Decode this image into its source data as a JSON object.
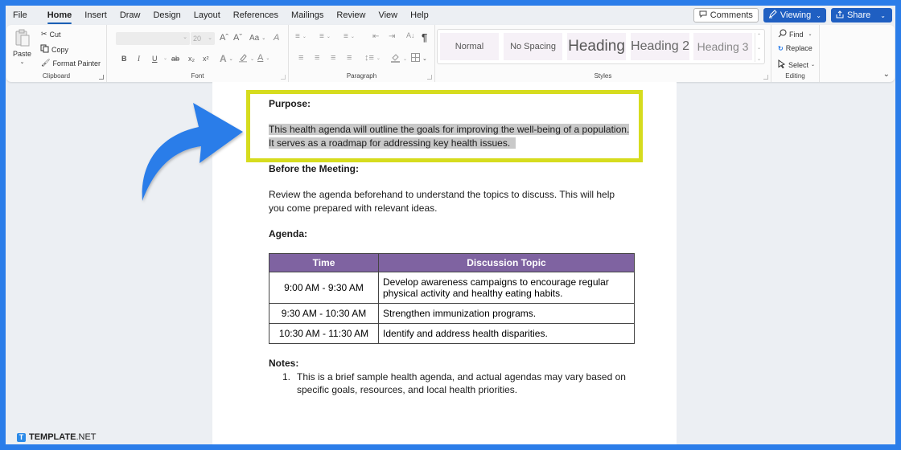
{
  "menu": {
    "tabs": [
      "File",
      "Home",
      "Insert",
      "Draw",
      "Design",
      "Layout",
      "References",
      "Mailings",
      "Review",
      "View",
      "Help"
    ],
    "active_tab": "Home",
    "comments_label": "Comments",
    "viewing_label": "Viewing",
    "share_label": "Share"
  },
  "ribbon": {
    "clipboard": {
      "label": "Clipboard",
      "paste": "Paste",
      "cut": "Cut",
      "copy": "Copy",
      "format_painter": "Format Painter"
    },
    "font": {
      "label": "Font",
      "font_name": "",
      "font_size": "20",
      "grow": "Aˆ",
      "shrink": "Aˇ",
      "change_case": "Aa",
      "clear_format": "A",
      "bold": "B",
      "italic": "I",
      "underline": "U",
      "strike": "ab",
      "subscript": "x₂",
      "superscript": "x²"
    },
    "paragraph": {
      "label": "Paragraph",
      "pilcrow": "¶"
    },
    "styles": {
      "label": "Styles",
      "items": [
        "Normal",
        "No Spacing",
        "Heading",
        "Heading 2",
        "Heading 3"
      ]
    },
    "editing": {
      "label": "Editing",
      "find": "Find",
      "replace": "Replace",
      "select": "Select"
    }
  },
  "document": {
    "purpose_heading": "Purpose:",
    "purpose_line1": "This health agenda will outline the goals for improving the well-being of a population.",
    "purpose_line2": "It serves as a roadmap for addressing key health issues.",
    "before_heading": "Before the Meeting:",
    "before_line1": "Review the agenda beforehand to understand the topics to discuss. This will help",
    "before_line2": "you come prepared with relevant ideas.",
    "agenda_heading": "Agenda:",
    "table": {
      "headers": [
        "Time",
        "Discussion Topic"
      ],
      "rows": [
        [
          "9:00 AM - 9:30 AM",
          "Develop awareness campaigns to encourage regular physical activity and healthy eating habits."
        ],
        [
          "9:30 AM - 10:30 AM",
          "Strengthen immunization programs."
        ],
        [
          "10:30 AM - 11:30 AM",
          "Identify and address health disparities."
        ]
      ]
    },
    "notes_heading": "Notes:",
    "notes_items": [
      {
        "num": "1.",
        "line1": "This is a brief sample health agenda, and actual agendas may vary based on",
        "line2": "specific goals, resources, and local health priorities."
      }
    ]
  },
  "colors": {
    "frame_blue": "#2b7de9",
    "highlight_box": "#d6dc1e",
    "table_header": "#7f63a1",
    "selection": "#c9c9c9"
  },
  "watermark": {
    "logo_letter": "T",
    "text_bold": "TEMPLATE",
    "text_light": ".NET"
  }
}
